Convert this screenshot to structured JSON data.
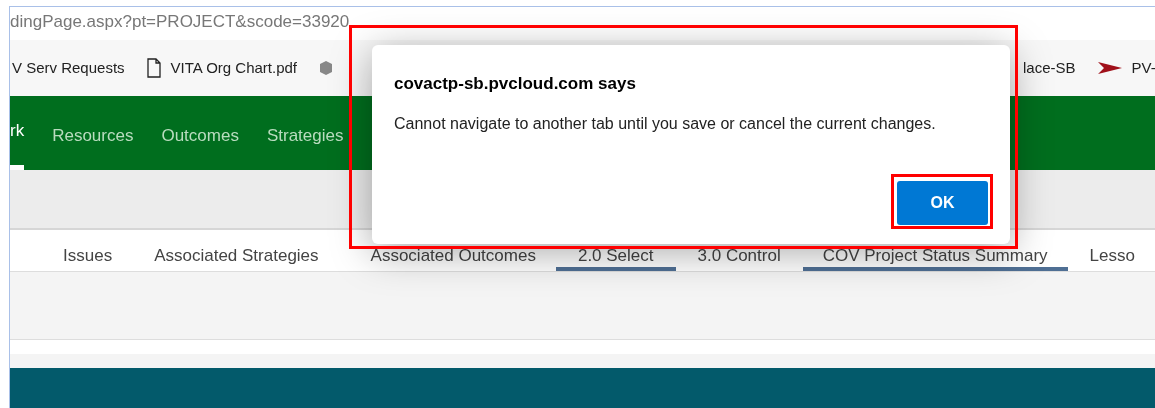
{
  "address_bar": {
    "url": "dingPage.aspx?pt=PROJECT&scode=33920"
  },
  "bookmarks": [
    {
      "kind": "plain",
      "label": "V Serv Requests"
    },
    {
      "kind": "file",
      "label": "VITA Org Chart.pdf"
    },
    {
      "kind": "cube"
    },
    {
      "kind": "plain",
      "label": "lace-SB"
    },
    {
      "kind": "arrow",
      "label": "PV-"
    }
  ],
  "nav": [
    {
      "label": "rk",
      "selected": true
    },
    {
      "label": "Resources",
      "selected": false
    },
    {
      "label": "Outcomes",
      "selected": false
    },
    {
      "label": "Strategies",
      "selected": false
    }
  ],
  "tabs": [
    {
      "label": "Issues",
      "selected": false
    },
    {
      "label": "Associated Strategies",
      "selected": false
    },
    {
      "label": "Associated Outcomes",
      "selected": false
    },
    {
      "label": "2.0 Select",
      "selected": true
    },
    {
      "label": "3.0 Control",
      "selected": false
    },
    {
      "label": "COV Project Status Summary",
      "selected": true
    },
    {
      "label": "Lesso",
      "selected": false
    }
  ],
  "dialog": {
    "title": "covactp-sb.pvcloud.com says",
    "message": "Cannot navigate to another tab until you save or cancel the current changes.",
    "button": "OK"
  }
}
